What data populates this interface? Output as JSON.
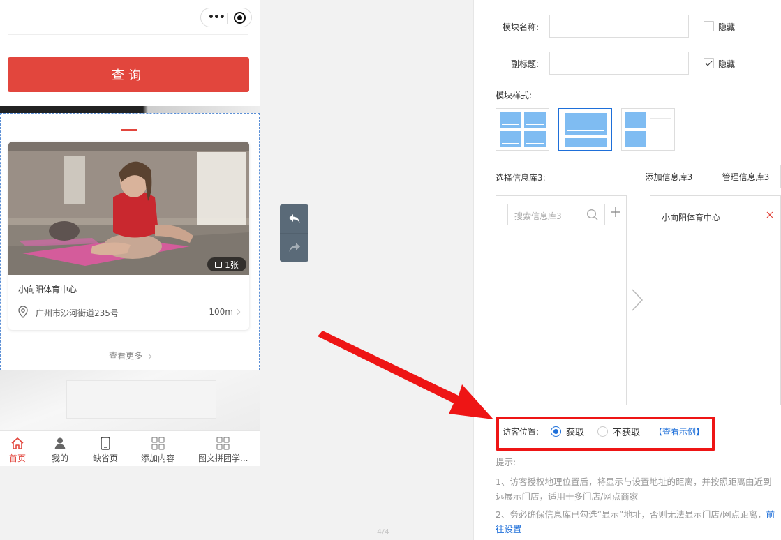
{
  "phone": {
    "query_button": "查询",
    "store_card": {
      "photo_badge": "1张",
      "name": "小向阳体育中心",
      "address": "广州市沙河街道235号",
      "distance": "100m"
    },
    "see_more": "查看更多",
    "tabbar": [
      {
        "label": "首页",
        "icon": "home-icon",
        "active": true
      },
      {
        "label": "我的",
        "icon": "user-icon",
        "active": false
      },
      {
        "label": "缺省页",
        "icon": "mobile-icon",
        "active": false
      },
      {
        "label": "添加内容",
        "icon": "grid-icon",
        "active": false
      },
      {
        "label": "图文拼团学...",
        "icon": "grid-icon",
        "active": false
      }
    ]
  },
  "page_indicator": "4/4",
  "panel": {
    "module_name": {
      "label": "模块名称:",
      "value": "",
      "hide_label": "隐藏",
      "hidden": false
    },
    "subtitle": {
      "label": "副标题:",
      "value": "",
      "hide_label": "隐藏",
      "hidden": true
    },
    "module_style": {
      "label": "模块样式:",
      "options": [
        "grid",
        "list",
        "thumbnail"
      ],
      "selected": 1
    },
    "library": {
      "label": "选择信息库3:",
      "add_button": "添加信息库3",
      "manage_button": "管理信息库3",
      "search_placeholder": "搜索信息库3",
      "selected_items": [
        "小向阳体育中心"
      ]
    },
    "visitor_location": {
      "label": "访客位置:",
      "options": [
        "获取",
        "不获取"
      ],
      "selected": 0,
      "example_link": "【查看示例】"
    },
    "tips": {
      "title": "提示:",
      "line1": "1、访客授权地理位置后，将显示与设置地址的距离，并按照距离由近到远展示门店，适用于多门店/网点商家",
      "line2": "2、务必确保信息库已勾选“显示”地址，否则无法显示门店/网点距离，",
      "line2_link": "前往设置"
    }
  },
  "colors": {
    "accent_red": "#e2463d",
    "link_blue": "#1e6fd9",
    "annotation_red": "#ee1515"
  }
}
